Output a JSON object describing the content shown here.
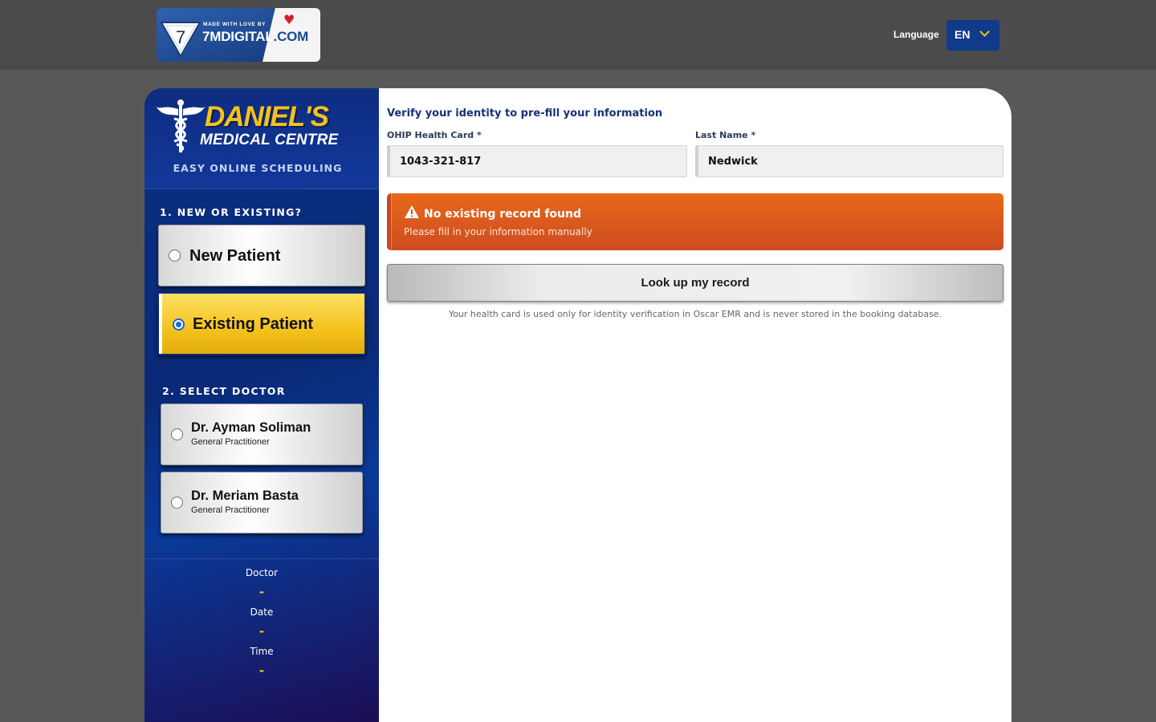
{
  "topbar": {
    "brand_small": "MADE WITH LOVE BY",
    "brand_main": "7MDIGITAL",
    "brand_tld": ".COM",
    "brand_digit": "7",
    "language_label": "Language",
    "language_value": "EN"
  },
  "sidebar": {
    "logo_name": "DANIEL'S",
    "logo_sub": "MEDICAL CENTRE",
    "tagline": "EASY ONLINE SCHEDULING",
    "section1_title": "1. NEW OR EXISTING?",
    "patient_options": [
      {
        "label": "New Patient",
        "selected": false
      },
      {
        "label": "Existing Patient",
        "selected": true
      }
    ],
    "section2_title": "2. SELECT DOCTOR",
    "doctors": [
      {
        "name": "Dr. Ayman Soliman",
        "specialty": "General Practitioner",
        "selected": false
      },
      {
        "name": "Dr. Meriam Basta",
        "specialty": "General Practitioner",
        "selected": false
      }
    ],
    "summary": {
      "doctor_label": "Doctor",
      "doctor_value": "-",
      "date_label": "Date",
      "date_value": "-",
      "time_label": "Time",
      "time_value": "-"
    }
  },
  "main": {
    "verify_title": "Verify your identity to pre-fill your information",
    "health_card_label": "OHIP Health Card *",
    "health_card_value": "1043-321-817",
    "last_name_label": "Last Name *",
    "last_name_value": "Nedwick",
    "alert_title": "No existing record found",
    "alert_text": "Please fill in your information manually",
    "lookup_button": "Look up my record",
    "privacy_note": "Your health card is used only for identity verification in Oscar EMR and is never stored in the booking database."
  },
  "colors": {
    "sidebar_blue": "#0a2a78",
    "accent_yellow": "#f5c518",
    "alert_orange": "#e0601c"
  }
}
